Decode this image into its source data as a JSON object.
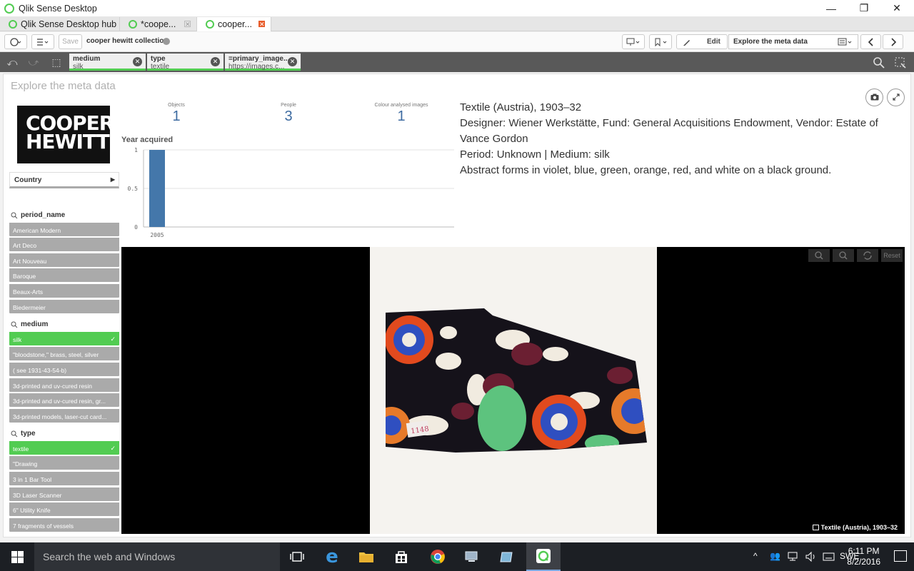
{
  "window": {
    "title": "Qlik Sense Desktop",
    "minimize": "—",
    "maximize": "❐",
    "close": "✕"
  },
  "tabs": [
    {
      "label": "Qlik Sense Desktop hub"
    },
    {
      "label": "*coope...",
      "close": "✕"
    },
    {
      "label": "cooper...",
      "close": "✕"
    }
  ],
  "toolbar": {
    "save_label": "Save",
    "app_name": "cooper hewitt collection",
    "edit_label": "Edit",
    "sheet_name": "Explore the meta data"
  },
  "selections": [
    {
      "field": "medium",
      "value": "silk"
    },
    {
      "field": "type",
      "value": "textile"
    },
    {
      "field": "=primary_image...",
      "value": "https://images.c..."
    }
  ],
  "sheet": {
    "title": "Explore the meta data"
  },
  "logo": {
    "line1": "COOPER",
    "line2": "HEWITT"
  },
  "country": {
    "label": "Country"
  },
  "kpis": [
    {
      "label": "Objects",
      "value": "1"
    },
    {
      "label": "People",
      "value": "3"
    },
    {
      "label": "Colour analysed images",
      "value": "1"
    }
  ],
  "chart_data": {
    "type": "bar",
    "title": "Year acquired",
    "categories": [
      "2005"
    ],
    "values": [
      1
    ],
    "ylim": [
      0,
      1
    ],
    "yticks": [
      "1",
      "0.5",
      "0"
    ],
    "grid": true,
    "color": "#4477aa"
  },
  "listboxes": {
    "period_name": {
      "title": "period_name",
      "items": [
        "American Modern",
        "Art Deco",
        "Art Nouveau",
        "Baroque",
        "Beaux-Arts",
        "Biedermeier"
      ]
    },
    "medium": {
      "title": "medium",
      "items": [
        "silk",
        "\"bloodstone,\" brass, steel, silver",
        "( see 1931-43-54-b)",
        "3d-printed and uv-cured resin",
        "3d-printed and uv-cured resin, gr...",
        "3d-printed models, laser-cut card..."
      ],
      "selected": "silk"
    },
    "type": {
      "title": "type",
      "items": [
        "textile",
        "\"Drawing",
        "3 in 1 Bar Tool",
        "3D Laser Scanner",
        "6\" Utility Knife",
        "7 fragments of vessels"
      ],
      "selected": "textile"
    }
  },
  "info": {
    "title": "Textile (Austria), 1903–32",
    "credit": "Designer: Wiener Werkstätte, Fund: General Acquisitions Endowment, Vendor: Estate of Vance Gordon",
    "period": "Period: Unknown | Medium: silk",
    "description": "Abstract forms in violet, blue, green, orange, red, and white on a black ground."
  },
  "viewer": {
    "reset_label": "Reset",
    "caption": "Textile (Austria), 1903–32",
    "tag_text": "1148"
  },
  "taskbar": {
    "search_placeholder": "Search the web and Windows",
    "language": "SWE",
    "time": "6:11 PM",
    "date": "8/2/2016"
  },
  "colors": {
    "selected_green": "#52cc52",
    "kpi_blue": "#3c6aa0",
    "selbar": "#595959"
  }
}
